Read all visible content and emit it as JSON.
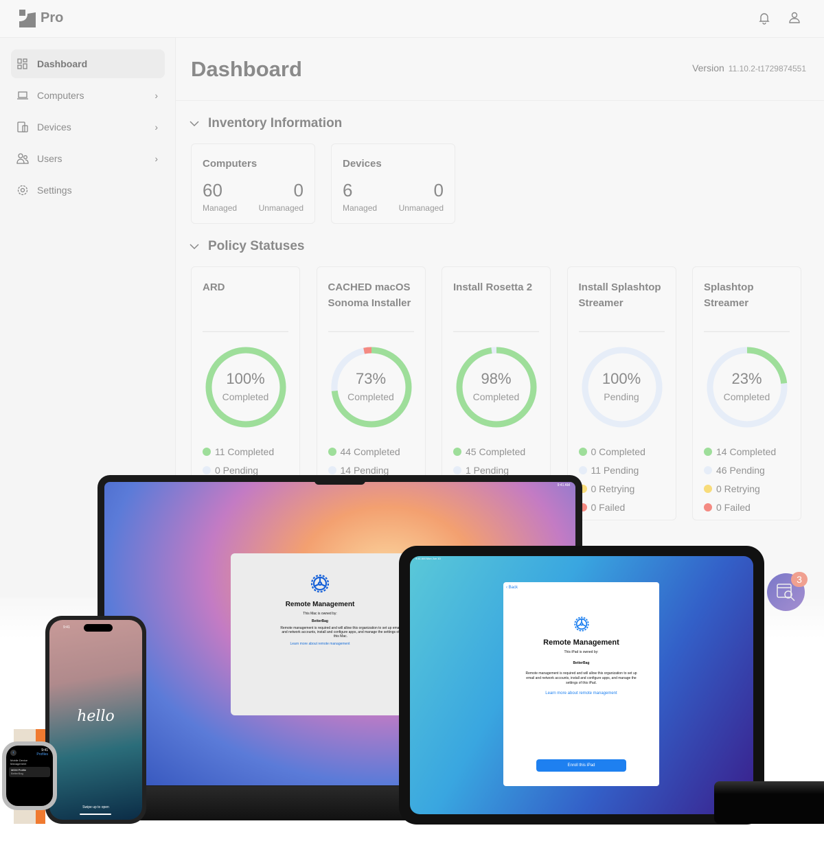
{
  "header": {
    "brand": "Pro",
    "icons": [
      "bell-icon",
      "user-icon"
    ]
  },
  "sidebar": {
    "items": [
      {
        "label": "Dashboard",
        "icon": "dashboard-icon",
        "active": true
      },
      {
        "label": "Computers",
        "icon": "laptop-icon",
        "chevron": true
      },
      {
        "label": "Devices",
        "icon": "devices-icon",
        "chevron": true
      },
      {
        "label": "Users",
        "icon": "users-icon",
        "chevron": true
      },
      {
        "label": "Settings",
        "icon": "gear-icon"
      }
    ]
  },
  "main": {
    "title": "Dashboard",
    "version_label": "Version",
    "version": "11.10.2-t1729874551",
    "inventory": {
      "title": "Inventory Information",
      "cards": [
        {
          "title": "Computers",
          "managed": "60",
          "managed_label": "Managed",
          "unmanaged": "0",
          "unmanaged_label": "Unmanaged"
        },
        {
          "title": "Devices",
          "managed": "6",
          "managed_label": "Managed",
          "unmanaged": "0",
          "unmanaged_label": "Unmanaged"
        }
      ]
    },
    "policies": {
      "title": "Policy Statuses",
      "colors": {
        "completed": "#9ede9a",
        "pending": "#e6edf8",
        "retrying": "#f8dc7a",
        "failed": "#f48a82"
      },
      "cards": [
        {
          "title": "ARD",
          "percent": "100%",
          "state": "Completed",
          "segments": {
            "completed": 11,
            "pending": 0,
            "failed": 0
          },
          "legend": [
            "11 Completed",
            "0 Pending"
          ]
        },
        {
          "title": "CACHED macOS Sonoma Installer",
          "percent": "73%",
          "state": "Completed",
          "segments": {
            "completed": 44,
            "pending": 14,
            "failed": 2
          },
          "legend": [
            "44 Completed",
            "14 Pending"
          ]
        },
        {
          "title": "Install Rosetta 2",
          "percent": "98%",
          "state": "Completed",
          "segments": {
            "completed": 45,
            "pending": 1,
            "failed": 0
          },
          "legend": [
            "45 Completed",
            "1 Pending"
          ]
        },
        {
          "title": "Install Splashtop Streamer",
          "percent": "100%",
          "state": "Pending",
          "segments": {
            "completed": 0,
            "pending": 11,
            "failed": 0
          },
          "legend": [
            "0 Completed",
            "11 Pending",
            "0 Retrying",
            "0 Failed"
          ]
        },
        {
          "title": "Splashtop Streamer",
          "percent": "23%",
          "state": "Completed",
          "segments": {
            "completed": 14,
            "pending": 46,
            "failed": 0
          },
          "legend": [
            "14 Completed",
            "46 Pending",
            "0 Retrying",
            "0 Failed"
          ]
        }
      ]
    }
  },
  "fab": {
    "icon": "search-window-icon",
    "badge": "3"
  },
  "mac_dialog": {
    "title": "Remote Management",
    "owned": "This Mac is owned by:",
    "org": "BetterBag",
    "body": "Remote management is required and will allow this organization to set up email and network accounts, install and configure apps, and manage the settings of this Mac.",
    "link": "Learn more about remote management",
    "status_time": "9:41 AM"
  },
  "ipad_dialog": {
    "back": "Back",
    "title": "Remote Management",
    "owned": "This iPad is owned by:",
    "org": "BetterBag",
    "body": "Remote management is required and will allow this organization to set up email and network accounts, install and configure apps, and manage the settings of this iPad.",
    "link": "Learn more about remote management",
    "button": "Enroll this iPad",
    "status_time": "9:41 AM  Mon Jun 10"
  },
  "iphone": {
    "time": "9:41",
    "greeting": "hello",
    "swipe": "Swipe up to open"
  },
  "watch": {
    "time": "9:41",
    "title": "Profiles",
    "section": "Mobile Device Management",
    "item": "MDM Profile",
    "item_sub": "BetterBag"
  }
}
